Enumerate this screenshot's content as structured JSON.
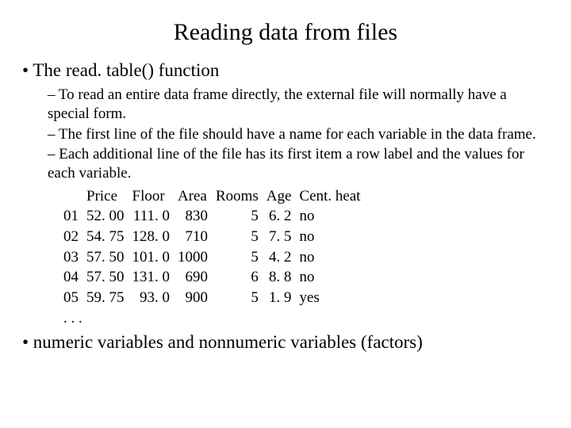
{
  "title": "Reading data from files",
  "bullet1": "• The read. table() function",
  "sub1": "– To read an entire data frame directly, the external file will normally have a special form.",
  "sub2": "– The first line of the file should have a name for each variable in the data frame.",
  "sub3": "– Each additional line of the file has its first item a row label and the values for each variable.",
  "headers": {
    "c0": "",
    "c1": "Price",
    "c2": "Floor",
    "c3": "Area",
    "c4": "Rooms",
    "c5": "Age",
    "c6": "Cent. heat"
  },
  "rows": [
    {
      "id": "01",
      "price": "52. 00",
      "floor": "111. 0",
      "area": "830",
      "rooms": "5",
      "age": "6. 2",
      "heat": "no"
    },
    {
      "id": "02",
      "price": "54. 75",
      "floor": "128. 0",
      "area": "710",
      "rooms": "5",
      "age": "7. 5",
      "heat": "no"
    },
    {
      "id": "03",
      "price": "57. 50",
      "floor": "101. 0",
      "area": "1000",
      "rooms": "5",
      "age": "4. 2",
      "heat": "no"
    },
    {
      "id": "04",
      "price": "57. 50",
      "floor": "131. 0",
      "area": "690",
      "rooms": "6",
      "age": "8. 8",
      "heat": "no"
    },
    {
      "id": "05",
      "price": "59. 75",
      "floor": "93. 0",
      "area": "900",
      "rooms": "5",
      "age": "1. 9",
      "heat": "yes"
    }
  ],
  "ellipsis": ". . .",
  "bullet2": "• numeric variables and nonnumeric variables (factors)"
}
